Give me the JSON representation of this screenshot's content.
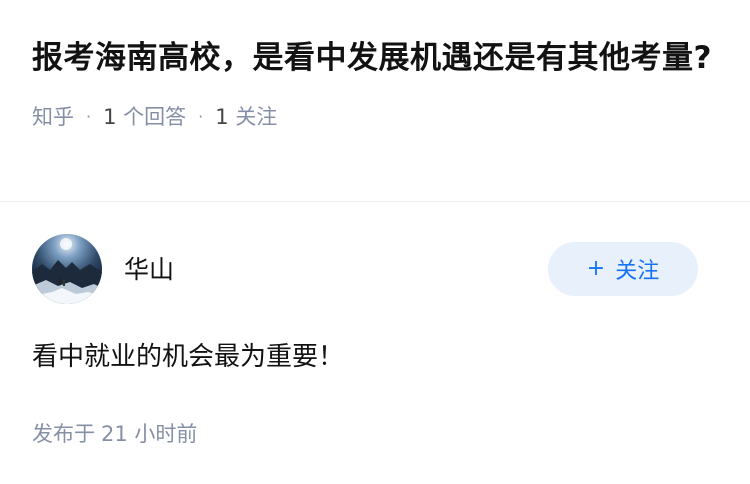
{
  "question": {
    "title": "报考海南高校，是看中发展机遇还是有其他考量?",
    "source": "知乎",
    "answer_count": "1",
    "answer_label": "个回答",
    "follow_count": "1",
    "follow_label": "关注"
  },
  "answer": {
    "author_name": "华山",
    "follow_button_label": "关注",
    "follow_button_icon": "plus-icon",
    "content": "看中就业的机会最为重要！",
    "time_prefix": "发布于",
    "time_value": "21 小时前"
  },
  "colors": {
    "accent": "#1772f6",
    "button_bg": "#e8f0fb",
    "meta_text": "#8590a6",
    "primary_text": "#121212"
  }
}
